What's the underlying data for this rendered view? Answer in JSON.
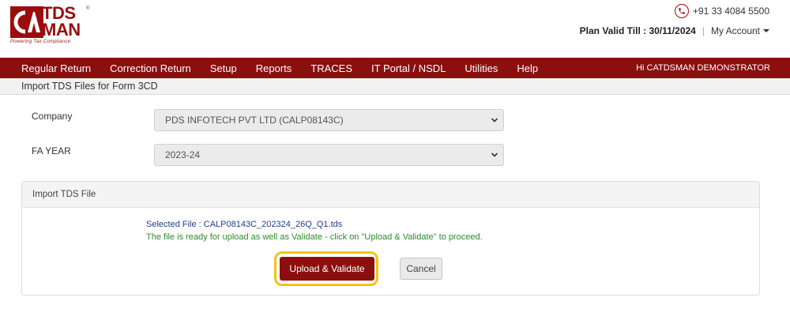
{
  "brand": {
    "logo_mark": "CA",
    "name_line1": "TDS",
    "name_line2": "MAN",
    "registered": "®",
    "tagline": "Powering Tax Compliance",
    "color": "#9b0d0d"
  },
  "header": {
    "phone": "+91 33 4084 5500",
    "plan_validity": "Plan Valid Till : 30/11/2024",
    "separator": "|",
    "account_label": "My Account"
  },
  "nav": {
    "items": [
      "Regular Return",
      "Correction Return",
      "Setup",
      "Reports",
      "TRACES",
      "IT Portal / NSDL",
      "Utilities",
      "Help"
    ],
    "user_greeting": "Hi CATDSMAN DEMONSTRATOR",
    "background": "#8b0f0f"
  },
  "page": {
    "title": "Import TDS Files for Form 3CD"
  },
  "form": {
    "company_label": "Company",
    "company_value": "PDS INFOTECH PVT LTD (CALP08143C)",
    "fa_year_label": "FA YEAR",
    "fa_year_value": "2023-24"
  },
  "import_panel": {
    "title": "Import TDS File",
    "selected_file": "Selected File : CALP08143C_202324_26Q_Q1.tds",
    "ready_message": "The file is ready for upload as well as Validate - click on \"Upload & Validate\" to proceed.",
    "upload_button": "Upload & Validate",
    "cancel_button": "Cancel",
    "highlight_color": "#f2c21b"
  }
}
